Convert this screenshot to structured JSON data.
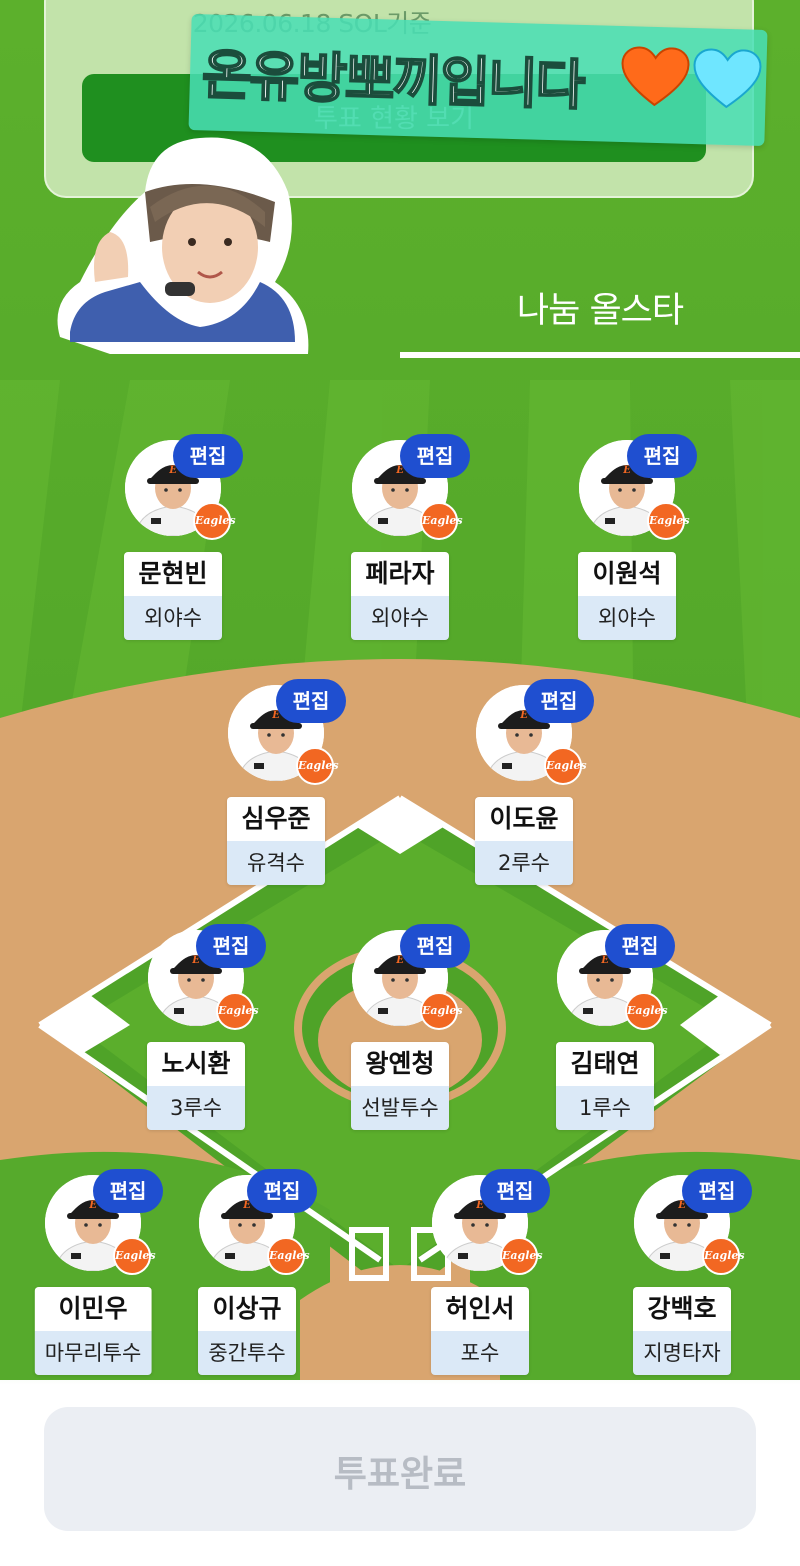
{
  "header": {
    "date_text": "2026.06.18 SOL기준",
    "status_button": "투표 현황 보기",
    "banner_text": "온유방뽀끼입니다",
    "hearts": [
      "orange-heart-icon",
      "light-blue-heart-icon"
    ]
  },
  "team": {
    "name": "나눔 올스타"
  },
  "edit_label": "편집",
  "logo_text": "Eagles",
  "players": [
    {
      "name": "문현빈",
      "position": "외야수"
    },
    {
      "name": "페라자",
      "position": "외야수"
    },
    {
      "name": "이원석",
      "position": "외야수"
    },
    {
      "name": "심우준",
      "position": "유격수"
    },
    {
      "name": "이도윤",
      "position": "2루수"
    },
    {
      "name": "노시환",
      "position": "3루수"
    },
    {
      "name": "왕옌청",
      "position": "선발투수"
    },
    {
      "name": "김태연",
      "position": "1루수"
    },
    {
      "name": "이민우",
      "position": "마무리투수"
    },
    {
      "name": "이상규",
      "position": "중간투수"
    },
    {
      "name": "허인서",
      "position": "포수"
    },
    {
      "name": "강백호",
      "position": "지명타자"
    }
  ],
  "footer": {
    "vote_done": "투표완료"
  },
  "colors": {
    "grass": "#56aa2c",
    "infield_dirt": "#d9a56f",
    "edit_badge": "#1f4fd0",
    "position_bg": "#dbe9f7",
    "logo": "#f26722",
    "banner": "#48deb4"
  }
}
